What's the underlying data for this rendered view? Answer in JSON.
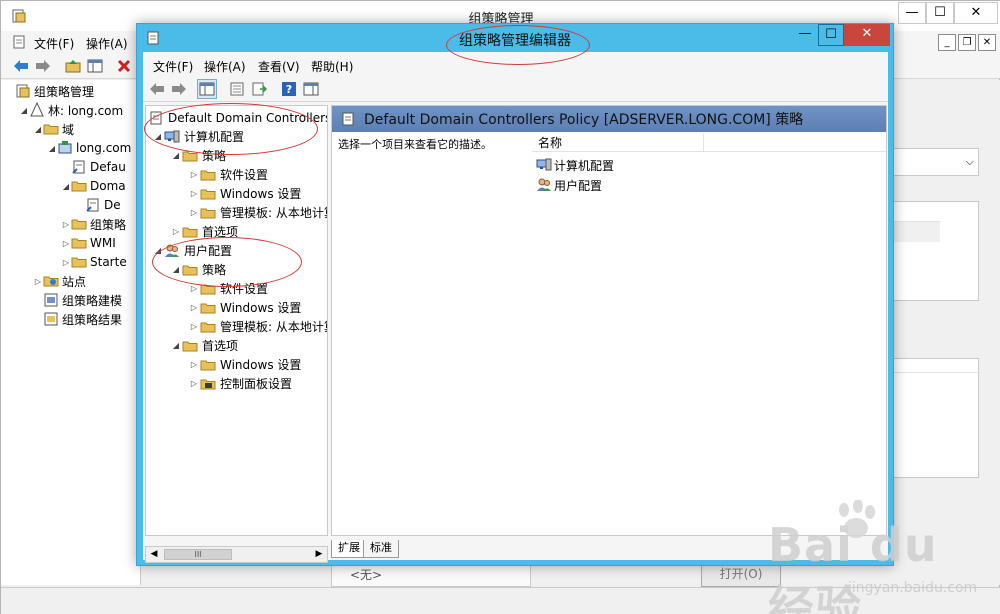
{
  "background_window": {
    "title": "组策略管理",
    "menu": {
      "file": "文件(F)",
      "action": "操作(A)"
    },
    "tree": [
      {
        "label": "组策略管理",
        "level": 0,
        "icon": "gpm-icon",
        "arrow": ""
      },
      {
        "label": "林: long.com",
        "level": 1,
        "icon": "forest-icon",
        "arrow": "expanded"
      },
      {
        "label": "域",
        "level": 2,
        "icon": "domains-folder-icon",
        "arrow": "expanded"
      },
      {
        "label": "long.com",
        "level": 3,
        "icon": "domain-icon",
        "arrow": "expanded"
      },
      {
        "label": "Defau",
        "level": 4,
        "icon": "gpo-link-icon",
        "arrow": ""
      },
      {
        "label": "Doma",
        "level": 4,
        "icon": "ou-folder-icon",
        "arrow": "expanded"
      },
      {
        "label": "De",
        "level": 5,
        "icon": "gpo-link-icon",
        "arrow": ""
      },
      {
        "label": "组策略",
        "level": 4,
        "icon": "gpo-folder-icon",
        "arrow": "collapsed"
      },
      {
        "label": "WMI",
        "level": 4,
        "icon": "wmi-folder-icon",
        "arrow": "collapsed"
      },
      {
        "label": "Starte",
        "level": 4,
        "icon": "starter-folder-icon",
        "arrow": "collapsed"
      },
      {
        "label": "站点",
        "level": 2,
        "icon": "sites-icon",
        "arrow": "collapsed"
      },
      {
        "label": "组策略建模",
        "level": 2,
        "icon": "modeling-icon",
        "arrow": ""
      },
      {
        "label": "组策略结果",
        "level": 2,
        "icon": "results-icon",
        "arrow": ""
      }
    ],
    "bottom_dropdown": "<无>",
    "bottom_button": "打开(O)"
  },
  "editor_window": {
    "title": "组策略管理编辑器",
    "controls": {
      "minimize": "—",
      "maximize": "☐",
      "close": "✕"
    },
    "menu": {
      "file": "文件(F)",
      "action": "操作(A)",
      "view": "查看(V)",
      "help": "帮助(H)"
    },
    "tree": [
      {
        "label": "Default Domain Controllers P",
        "level": 0,
        "icon": "gpo-icon",
        "arrow": ""
      },
      {
        "label": "计算机配置",
        "level": 1,
        "icon": "computer-config-icon",
        "arrow": "expanded"
      },
      {
        "label": "策略",
        "level": 2,
        "icon": "folder-icon",
        "arrow": "expanded"
      },
      {
        "label": "软件设置",
        "level": 3,
        "icon": "folder-icon",
        "arrow": "collapsed"
      },
      {
        "label": "Windows 设置",
        "level": 3,
        "icon": "folder-icon",
        "arrow": "collapsed"
      },
      {
        "label": "管理模板: 从本地计算",
        "level": 3,
        "icon": "folder-icon",
        "arrow": "collapsed"
      },
      {
        "label": "首选项",
        "level": 2,
        "icon": "folder-icon",
        "arrow": "collapsed"
      },
      {
        "label": "用户配置",
        "level": 1,
        "icon": "user-config-icon",
        "arrow": "expanded"
      },
      {
        "label": "策略",
        "level": 2,
        "icon": "folder-icon",
        "arrow": "expanded"
      },
      {
        "label": "软件设置",
        "level": 3,
        "icon": "folder-icon",
        "arrow": "collapsed"
      },
      {
        "label": "Windows 设置",
        "level": 3,
        "icon": "folder-icon",
        "arrow": "collapsed"
      },
      {
        "label": "管理模板: 从本地计算",
        "level": 3,
        "icon": "folder-icon",
        "arrow": "collapsed"
      },
      {
        "label": "首选项",
        "level": 2,
        "icon": "folder-icon",
        "arrow": "expanded"
      },
      {
        "label": "Windows 设置",
        "level": 3,
        "icon": "folder-icon",
        "arrow": "collapsed"
      },
      {
        "label": "控制面板设置",
        "level": 3,
        "icon": "control-panel-folder-icon",
        "arrow": "collapsed"
      }
    ],
    "content_title": "Default Domain Controllers Policy [ADSERVER.LONG.COM] 策略",
    "description_prompt": "选择一个项目来查看它的描述。",
    "column_name": "名称",
    "list_items": [
      {
        "label": "计算机配置",
        "icon": "computer-config-icon"
      },
      {
        "label": "用户配置",
        "icon": "user-config-icon"
      }
    ],
    "tabs": [
      "扩展",
      "标准"
    ],
    "scrollbar_thumb": "III"
  },
  "watermark": {
    "brand": "Bai du 经验",
    "url": "jingyan.baidu.com"
  },
  "colors": {
    "editor_frame": "#4bbbe8",
    "close_button": "#c9463d",
    "header_band": "#6f93c6",
    "annotation": "#d23a35",
    "folder": "#e8c15a"
  }
}
